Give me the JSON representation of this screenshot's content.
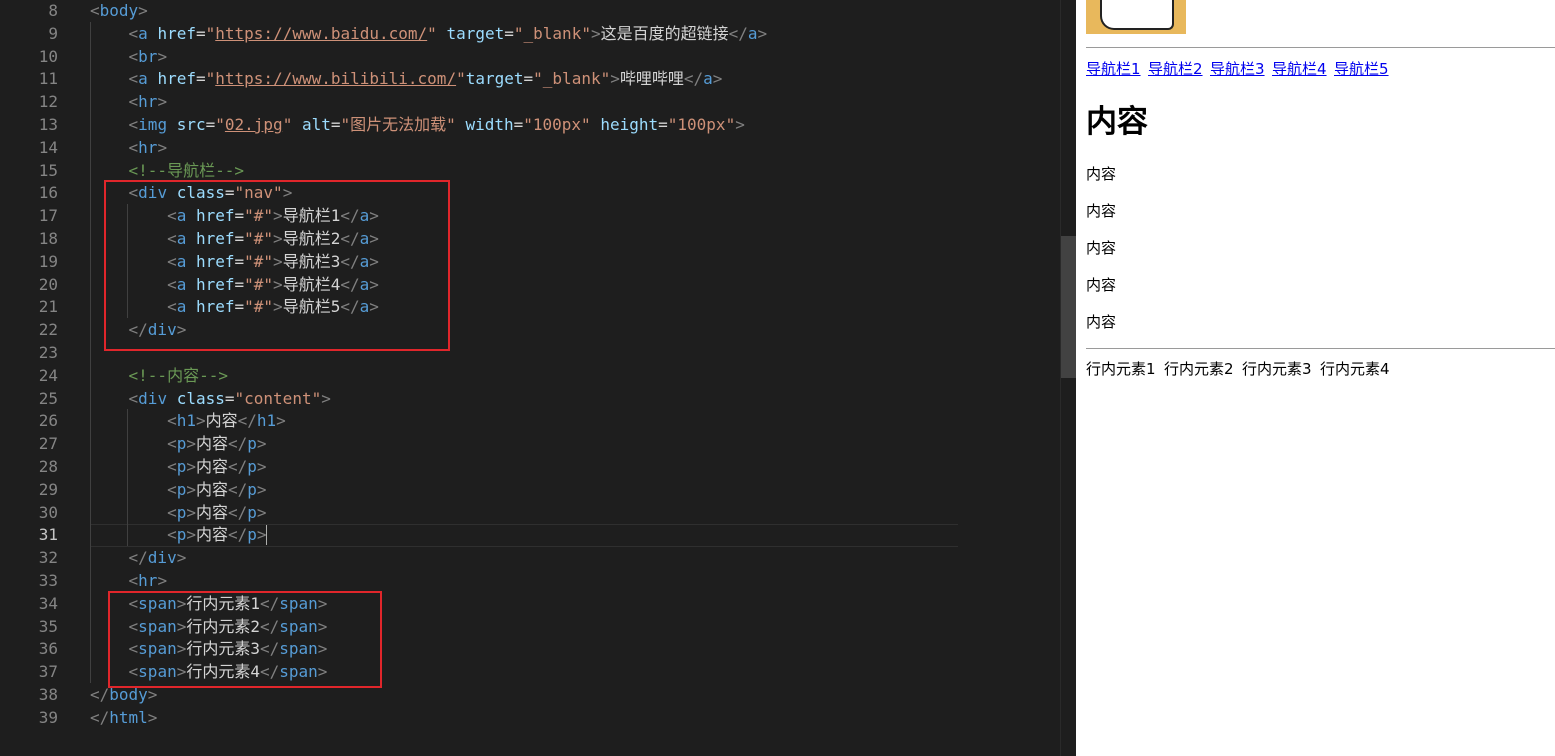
{
  "editor": {
    "active_line": "31",
    "lines": [
      {
        "num": "8",
        "tokens": [
          [
            "t-punc",
            "<"
          ],
          [
            "t-tag",
            "body"
          ],
          [
            "t-punc",
            ">"
          ]
        ]
      },
      {
        "num": "9",
        "tokens": [
          [
            "t-text",
            "    "
          ],
          [
            "t-punc",
            "<"
          ],
          [
            "t-tag",
            "a "
          ],
          [
            "t-attr",
            "href"
          ],
          [
            "t-text",
            "="
          ],
          [
            "t-str",
            "\""
          ],
          [
            "t-str t-link",
            "https://www.baidu.com/"
          ],
          [
            "t-str",
            "\""
          ],
          [
            "t-text",
            " "
          ],
          [
            "t-attr",
            "target"
          ],
          [
            "t-text",
            "="
          ],
          [
            "t-str",
            "\"_blank\""
          ],
          [
            "t-punc",
            ">"
          ],
          [
            "t-text",
            "这是百度的超链接"
          ],
          [
            "t-punc",
            "</"
          ],
          [
            "t-tag",
            "a"
          ],
          [
            "t-punc",
            ">"
          ]
        ]
      },
      {
        "num": "10",
        "tokens": [
          [
            "t-text",
            "    "
          ],
          [
            "t-punc",
            "<"
          ],
          [
            "t-tag",
            "br"
          ],
          [
            "t-punc",
            ">"
          ]
        ]
      },
      {
        "num": "11",
        "tokens": [
          [
            "t-text",
            "    "
          ],
          [
            "t-punc",
            "<"
          ],
          [
            "t-tag",
            "a "
          ],
          [
            "t-attr",
            "href"
          ],
          [
            "t-text",
            "="
          ],
          [
            "t-str",
            "\""
          ],
          [
            "t-str t-link",
            "https://www.bilibili.com/"
          ],
          [
            "t-str",
            "\""
          ],
          [
            "t-attr",
            "target"
          ],
          [
            "t-text",
            "="
          ],
          [
            "t-str",
            "\"_blank\""
          ],
          [
            "t-punc",
            ">"
          ],
          [
            "t-text",
            "哔哩哔哩"
          ],
          [
            "t-punc",
            "</"
          ],
          [
            "t-tag",
            "a"
          ],
          [
            "t-punc",
            ">"
          ]
        ]
      },
      {
        "num": "12",
        "tokens": [
          [
            "t-text",
            "    "
          ],
          [
            "t-punc",
            "<"
          ],
          [
            "t-tag",
            "hr"
          ],
          [
            "t-punc",
            ">"
          ]
        ]
      },
      {
        "num": "13",
        "tokens": [
          [
            "t-text",
            "    "
          ],
          [
            "t-punc",
            "<"
          ],
          [
            "t-tag",
            "img "
          ],
          [
            "t-attr",
            "src"
          ],
          [
            "t-text",
            "="
          ],
          [
            "t-str",
            "\""
          ],
          [
            "t-str t-link",
            "02.jpg"
          ],
          [
            "t-str",
            "\""
          ],
          [
            "t-text",
            " "
          ],
          [
            "t-attr",
            "alt"
          ],
          [
            "t-text",
            "="
          ],
          [
            "t-str",
            "\"图片无法加载\""
          ],
          [
            "t-text",
            " "
          ],
          [
            "t-attr",
            "width"
          ],
          [
            "t-text",
            "="
          ],
          [
            "t-str",
            "\"100px\""
          ],
          [
            "t-text",
            " "
          ],
          [
            "t-attr",
            "height"
          ],
          [
            "t-text",
            "="
          ],
          [
            "t-str",
            "\"100px\""
          ],
          [
            "t-punc",
            ">"
          ]
        ]
      },
      {
        "num": "14",
        "tokens": [
          [
            "t-text",
            "    "
          ],
          [
            "t-punc",
            "<"
          ],
          [
            "t-tag",
            "hr"
          ],
          [
            "t-punc",
            ">"
          ]
        ]
      },
      {
        "num": "15",
        "tokens": [
          [
            "t-text",
            "    "
          ],
          [
            "t-com",
            "<!--导航栏-->"
          ]
        ]
      },
      {
        "num": "16",
        "tokens": [
          [
            "t-text",
            "    "
          ],
          [
            "t-punc",
            "<"
          ],
          [
            "t-tag",
            "div "
          ],
          [
            "t-attr",
            "class"
          ],
          [
            "t-text",
            "="
          ],
          [
            "t-str",
            "\"nav\""
          ],
          [
            "t-punc",
            ">"
          ]
        ]
      },
      {
        "num": "17",
        "tokens": [
          [
            "t-text",
            "        "
          ],
          [
            "t-punc",
            "<"
          ],
          [
            "t-tag",
            "a "
          ],
          [
            "t-attr",
            "href"
          ],
          [
            "t-text",
            "="
          ],
          [
            "t-str",
            "\"#\""
          ],
          [
            "t-punc",
            ">"
          ],
          [
            "t-text",
            "导航栏1"
          ],
          [
            "t-punc",
            "</"
          ],
          [
            "t-tag",
            "a"
          ],
          [
            "t-punc",
            ">"
          ]
        ]
      },
      {
        "num": "18",
        "tokens": [
          [
            "t-text",
            "        "
          ],
          [
            "t-punc",
            "<"
          ],
          [
            "t-tag",
            "a "
          ],
          [
            "t-attr",
            "href"
          ],
          [
            "t-text",
            "="
          ],
          [
            "t-str",
            "\"#\""
          ],
          [
            "t-punc",
            ">"
          ],
          [
            "t-text",
            "导航栏2"
          ],
          [
            "t-punc",
            "</"
          ],
          [
            "t-tag",
            "a"
          ],
          [
            "t-punc",
            ">"
          ]
        ]
      },
      {
        "num": "19",
        "tokens": [
          [
            "t-text",
            "        "
          ],
          [
            "t-punc",
            "<"
          ],
          [
            "t-tag",
            "a "
          ],
          [
            "t-attr",
            "href"
          ],
          [
            "t-text",
            "="
          ],
          [
            "t-str",
            "\"#\""
          ],
          [
            "t-punc",
            ">"
          ],
          [
            "t-text",
            "导航栏3"
          ],
          [
            "t-punc",
            "</"
          ],
          [
            "t-tag",
            "a"
          ],
          [
            "t-punc",
            ">"
          ]
        ]
      },
      {
        "num": "20",
        "tokens": [
          [
            "t-text",
            "        "
          ],
          [
            "t-punc",
            "<"
          ],
          [
            "t-tag",
            "a "
          ],
          [
            "t-attr",
            "href"
          ],
          [
            "t-text",
            "="
          ],
          [
            "t-str",
            "\"#\""
          ],
          [
            "t-punc",
            ">"
          ],
          [
            "t-text",
            "导航栏4"
          ],
          [
            "t-punc",
            "</"
          ],
          [
            "t-tag",
            "a"
          ],
          [
            "t-punc",
            ">"
          ]
        ]
      },
      {
        "num": "21",
        "tokens": [
          [
            "t-text",
            "        "
          ],
          [
            "t-punc",
            "<"
          ],
          [
            "t-tag",
            "a "
          ],
          [
            "t-attr",
            "href"
          ],
          [
            "t-text",
            "="
          ],
          [
            "t-str",
            "\"#\""
          ],
          [
            "t-punc",
            ">"
          ],
          [
            "t-text",
            "导航栏5"
          ],
          [
            "t-punc",
            "</"
          ],
          [
            "t-tag",
            "a"
          ],
          [
            "t-punc",
            ">"
          ]
        ]
      },
      {
        "num": "22",
        "tokens": [
          [
            "t-text",
            "    "
          ],
          [
            "t-punc",
            "</"
          ],
          [
            "t-tag",
            "div"
          ],
          [
            "t-punc",
            ">"
          ]
        ]
      },
      {
        "num": "23",
        "tokens": []
      },
      {
        "num": "24",
        "tokens": [
          [
            "t-text",
            "    "
          ],
          [
            "t-com",
            "<!--内容-->"
          ]
        ]
      },
      {
        "num": "25",
        "tokens": [
          [
            "t-text",
            "    "
          ],
          [
            "t-punc",
            "<"
          ],
          [
            "t-tag",
            "div "
          ],
          [
            "t-attr",
            "class"
          ],
          [
            "t-text",
            "="
          ],
          [
            "t-str",
            "\"content\""
          ],
          [
            "t-punc",
            ">"
          ]
        ]
      },
      {
        "num": "26",
        "tokens": [
          [
            "t-text",
            "        "
          ],
          [
            "t-punc",
            "<"
          ],
          [
            "t-tag",
            "h1"
          ],
          [
            "t-punc",
            ">"
          ],
          [
            "t-text",
            "内容"
          ],
          [
            "t-punc",
            "</"
          ],
          [
            "t-tag",
            "h1"
          ],
          [
            "t-punc",
            ">"
          ]
        ]
      },
      {
        "num": "27",
        "tokens": [
          [
            "t-text",
            "        "
          ],
          [
            "t-punc",
            "<"
          ],
          [
            "t-tag",
            "p"
          ],
          [
            "t-punc",
            ">"
          ],
          [
            "t-text",
            "内容"
          ],
          [
            "t-punc",
            "</"
          ],
          [
            "t-tag",
            "p"
          ],
          [
            "t-punc",
            ">"
          ]
        ]
      },
      {
        "num": "28",
        "tokens": [
          [
            "t-text",
            "        "
          ],
          [
            "t-punc",
            "<"
          ],
          [
            "t-tag",
            "p"
          ],
          [
            "t-punc",
            ">"
          ],
          [
            "t-text",
            "内容"
          ],
          [
            "t-punc",
            "</"
          ],
          [
            "t-tag",
            "p"
          ],
          [
            "t-punc",
            ">"
          ]
        ]
      },
      {
        "num": "29",
        "tokens": [
          [
            "t-text",
            "        "
          ],
          [
            "t-punc",
            "<"
          ],
          [
            "t-tag",
            "p"
          ],
          [
            "t-punc",
            ">"
          ],
          [
            "t-text",
            "内容"
          ],
          [
            "t-punc",
            "</"
          ],
          [
            "t-tag",
            "p"
          ],
          [
            "t-punc",
            ">"
          ]
        ]
      },
      {
        "num": "30",
        "tokens": [
          [
            "t-text",
            "        "
          ],
          [
            "t-punc",
            "<"
          ],
          [
            "t-tag",
            "p"
          ],
          [
            "t-punc",
            ">"
          ],
          [
            "t-text",
            "内容"
          ],
          [
            "t-punc",
            "</"
          ],
          [
            "t-tag",
            "p"
          ],
          [
            "t-punc",
            ">"
          ]
        ]
      },
      {
        "num": "31",
        "tokens": [
          [
            "t-text",
            "        "
          ],
          [
            "t-punc",
            "<"
          ],
          [
            "t-tag",
            "p"
          ],
          [
            "t-punc",
            ">"
          ],
          [
            "t-text",
            "内容"
          ],
          [
            "t-punc",
            "</"
          ],
          [
            "t-tag",
            "p"
          ],
          [
            "t-punc",
            ">"
          ]
        ]
      },
      {
        "num": "32",
        "tokens": [
          [
            "t-text",
            "    "
          ],
          [
            "t-punc",
            "</"
          ],
          [
            "t-tag",
            "div"
          ],
          [
            "t-punc",
            ">"
          ]
        ]
      },
      {
        "num": "33",
        "tokens": [
          [
            "t-text",
            "    "
          ],
          [
            "t-punc",
            "<"
          ],
          [
            "t-tag",
            "hr"
          ],
          [
            "t-punc",
            ">"
          ]
        ]
      },
      {
        "num": "34",
        "tokens": [
          [
            "t-text",
            "    "
          ],
          [
            "t-punc",
            "<"
          ],
          [
            "t-tag",
            "span"
          ],
          [
            "t-punc",
            ">"
          ],
          [
            "t-text",
            "行内元素1"
          ],
          [
            "t-punc",
            "</"
          ],
          [
            "t-tag",
            "span"
          ],
          [
            "t-punc",
            ">"
          ]
        ]
      },
      {
        "num": "35",
        "tokens": [
          [
            "t-text",
            "    "
          ],
          [
            "t-punc",
            "<"
          ],
          [
            "t-tag",
            "span"
          ],
          [
            "t-punc",
            ">"
          ],
          [
            "t-text",
            "行内元素2"
          ],
          [
            "t-punc",
            "</"
          ],
          [
            "t-tag",
            "span"
          ],
          [
            "t-punc",
            ">"
          ]
        ]
      },
      {
        "num": "36",
        "tokens": [
          [
            "t-text",
            "    "
          ],
          [
            "t-punc",
            "<"
          ],
          [
            "t-tag",
            "span"
          ],
          [
            "t-punc",
            ">"
          ],
          [
            "t-text",
            "行内元素3"
          ],
          [
            "t-punc",
            "</"
          ],
          [
            "t-tag",
            "span"
          ],
          [
            "t-punc",
            ">"
          ]
        ]
      },
      {
        "num": "37",
        "tokens": [
          [
            "t-text",
            "    "
          ],
          [
            "t-punc",
            "<"
          ],
          [
            "t-tag",
            "span"
          ],
          [
            "t-punc",
            ">"
          ],
          [
            "t-text",
            "行内元素4"
          ],
          [
            "t-punc",
            "</"
          ],
          [
            "t-tag",
            "span"
          ],
          [
            "t-punc",
            ">"
          ]
        ]
      },
      {
        "num": "38",
        "tokens": [
          [
            "t-punc",
            "</"
          ],
          [
            "t-tag",
            "body"
          ],
          [
            "t-punc",
            ">"
          ]
        ]
      },
      {
        "num": "39",
        "tokens": [
          [
            "t-punc",
            "</"
          ],
          [
            "t-tag",
            "html"
          ],
          [
            "t-punc",
            ">"
          ]
        ]
      }
    ]
  },
  "preview": {
    "nav_links": [
      "导航栏1",
      "导航栏2",
      "导航栏3",
      "导航栏4",
      "导航栏5"
    ],
    "heading": "内容",
    "paragraphs": [
      "内容",
      "内容",
      "内容",
      "内容",
      "内容"
    ],
    "spans": [
      "行内元素1",
      "行内元素2",
      "行内元素3",
      "行内元素4"
    ]
  },
  "colors": {
    "editor_bg": "#1e1e1e",
    "tag": "#569cd6",
    "attr": "#9cdcfe",
    "string": "#ce9178",
    "comment": "#6a9955",
    "highlight_box": "#e0262b",
    "link": "#0000ee"
  }
}
